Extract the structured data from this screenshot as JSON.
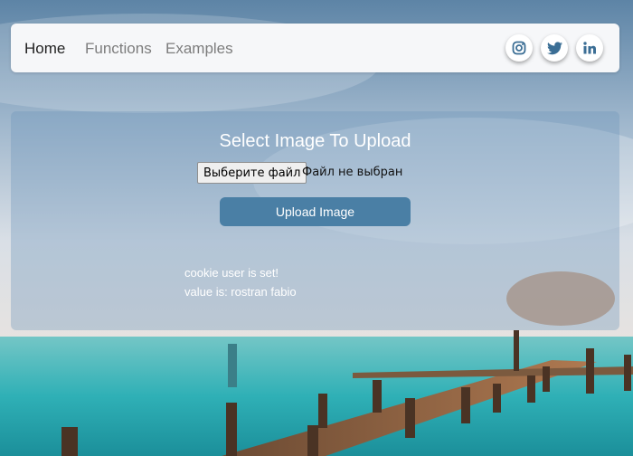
{
  "nav": {
    "links": [
      "Home",
      "Functions",
      "Examples"
    ],
    "social": [
      {
        "icon": "instagram-icon"
      },
      {
        "icon": "twitter-icon"
      },
      {
        "icon": "linkedin-icon"
      }
    ]
  },
  "upload": {
    "title": "Select Image To Upload",
    "choose_file": "Выберите файл",
    "file_status": "Файл не выбран",
    "button": "Upload Image"
  },
  "messages": {
    "cookie_set": "cookie user is set!",
    "value": "value is: rostran fabio"
  },
  "colors": {
    "accent": "#4a7fa5",
    "social_icon": "#3b6e95"
  }
}
